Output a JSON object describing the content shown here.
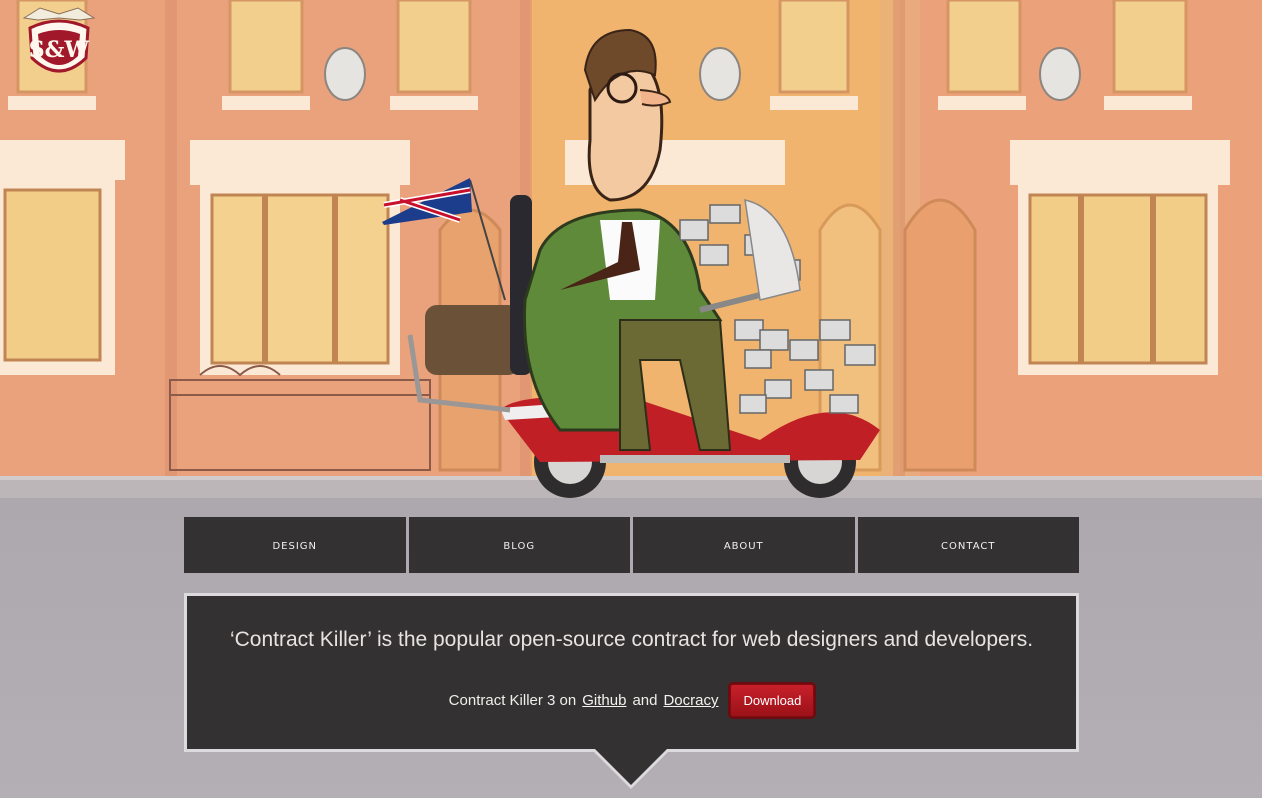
{
  "nav": {
    "items": [
      {
        "label": "Design"
      },
      {
        "label": "Blog"
      },
      {
        "label": "About"
      },
      {
        "label": "Contact"
      }
    ]
  },
  "intro": {
    "tagline": "‘Contract Killer’ is the popular open-source contract for web designers and developers.",
    "version_text": "Contract Killer 3 on",
    "github_link": "Github",
    "and_text": "and",
    "docracy_link": "Docracy",
    "download_button": "Download"
  },
  "colors": {
    "nav_bg": "#333132",
    "panel_bg": "#333132",
    "download_red": "#c7202a",
    "page_bg": "#b4afb4"
  },
  "logo": {
    "text": "S&W"
  }
}
